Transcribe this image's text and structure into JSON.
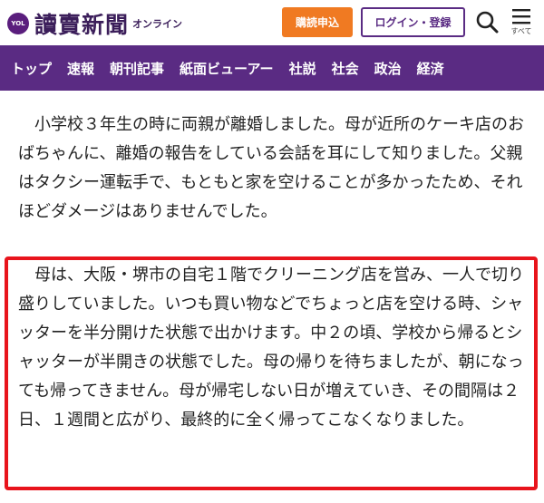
{
  "header": {
    "logo_badge": "YOL",
    "logo_text": "讀賣新聞",
    "logo_sub": "オンライン",
    "subscribe_label": "購読申込",
    "login_label": "ログイン・登録",
    "menu_label": "すべて",
    "icons": [
      "search-icon",
      "menu-icon"
    ]
  },
  "nav": {
    "items": [
      "トップ",
      "速報",
      "朝刊記事",
      "紙面ビューアー",
      "社説",
      "社会",
      "政治",
      "経済"
    ]
  },
  "article": {
    "paragraph1": "小学校３年生の時に両親が離婚しました。母が近所のケーキ店のおばちゃんに、離婚の報告をしている会話を耳にして知りました。父親はタクシー運転手で、もともと家を空けることが多かったため、それほどダメージはありませんでした。",
    "paragraph2": "母は、大阪・堺市の自宅１階でクリーニング店を営み、一人で切り盛りしていました。いつも買い物などでちょっと店を空ける時、シャッターを半分開けた状態で出かけます。中２の頃、学校から帰るとシャッターが半開きの状態でした。母の帰りを待ちましたが、朝になっても帰ってきません。母が帰宅しない日が増えていき、その間隔は２日、１週間と広がり、最終的に全く帰ってこなくなりました。"
  },
  "colors": {
    "brand_purple": "#5a2b83",
    "subscribe_orange": "#f07a22",
    "highlight_red": "#e8141c"
  }
}
